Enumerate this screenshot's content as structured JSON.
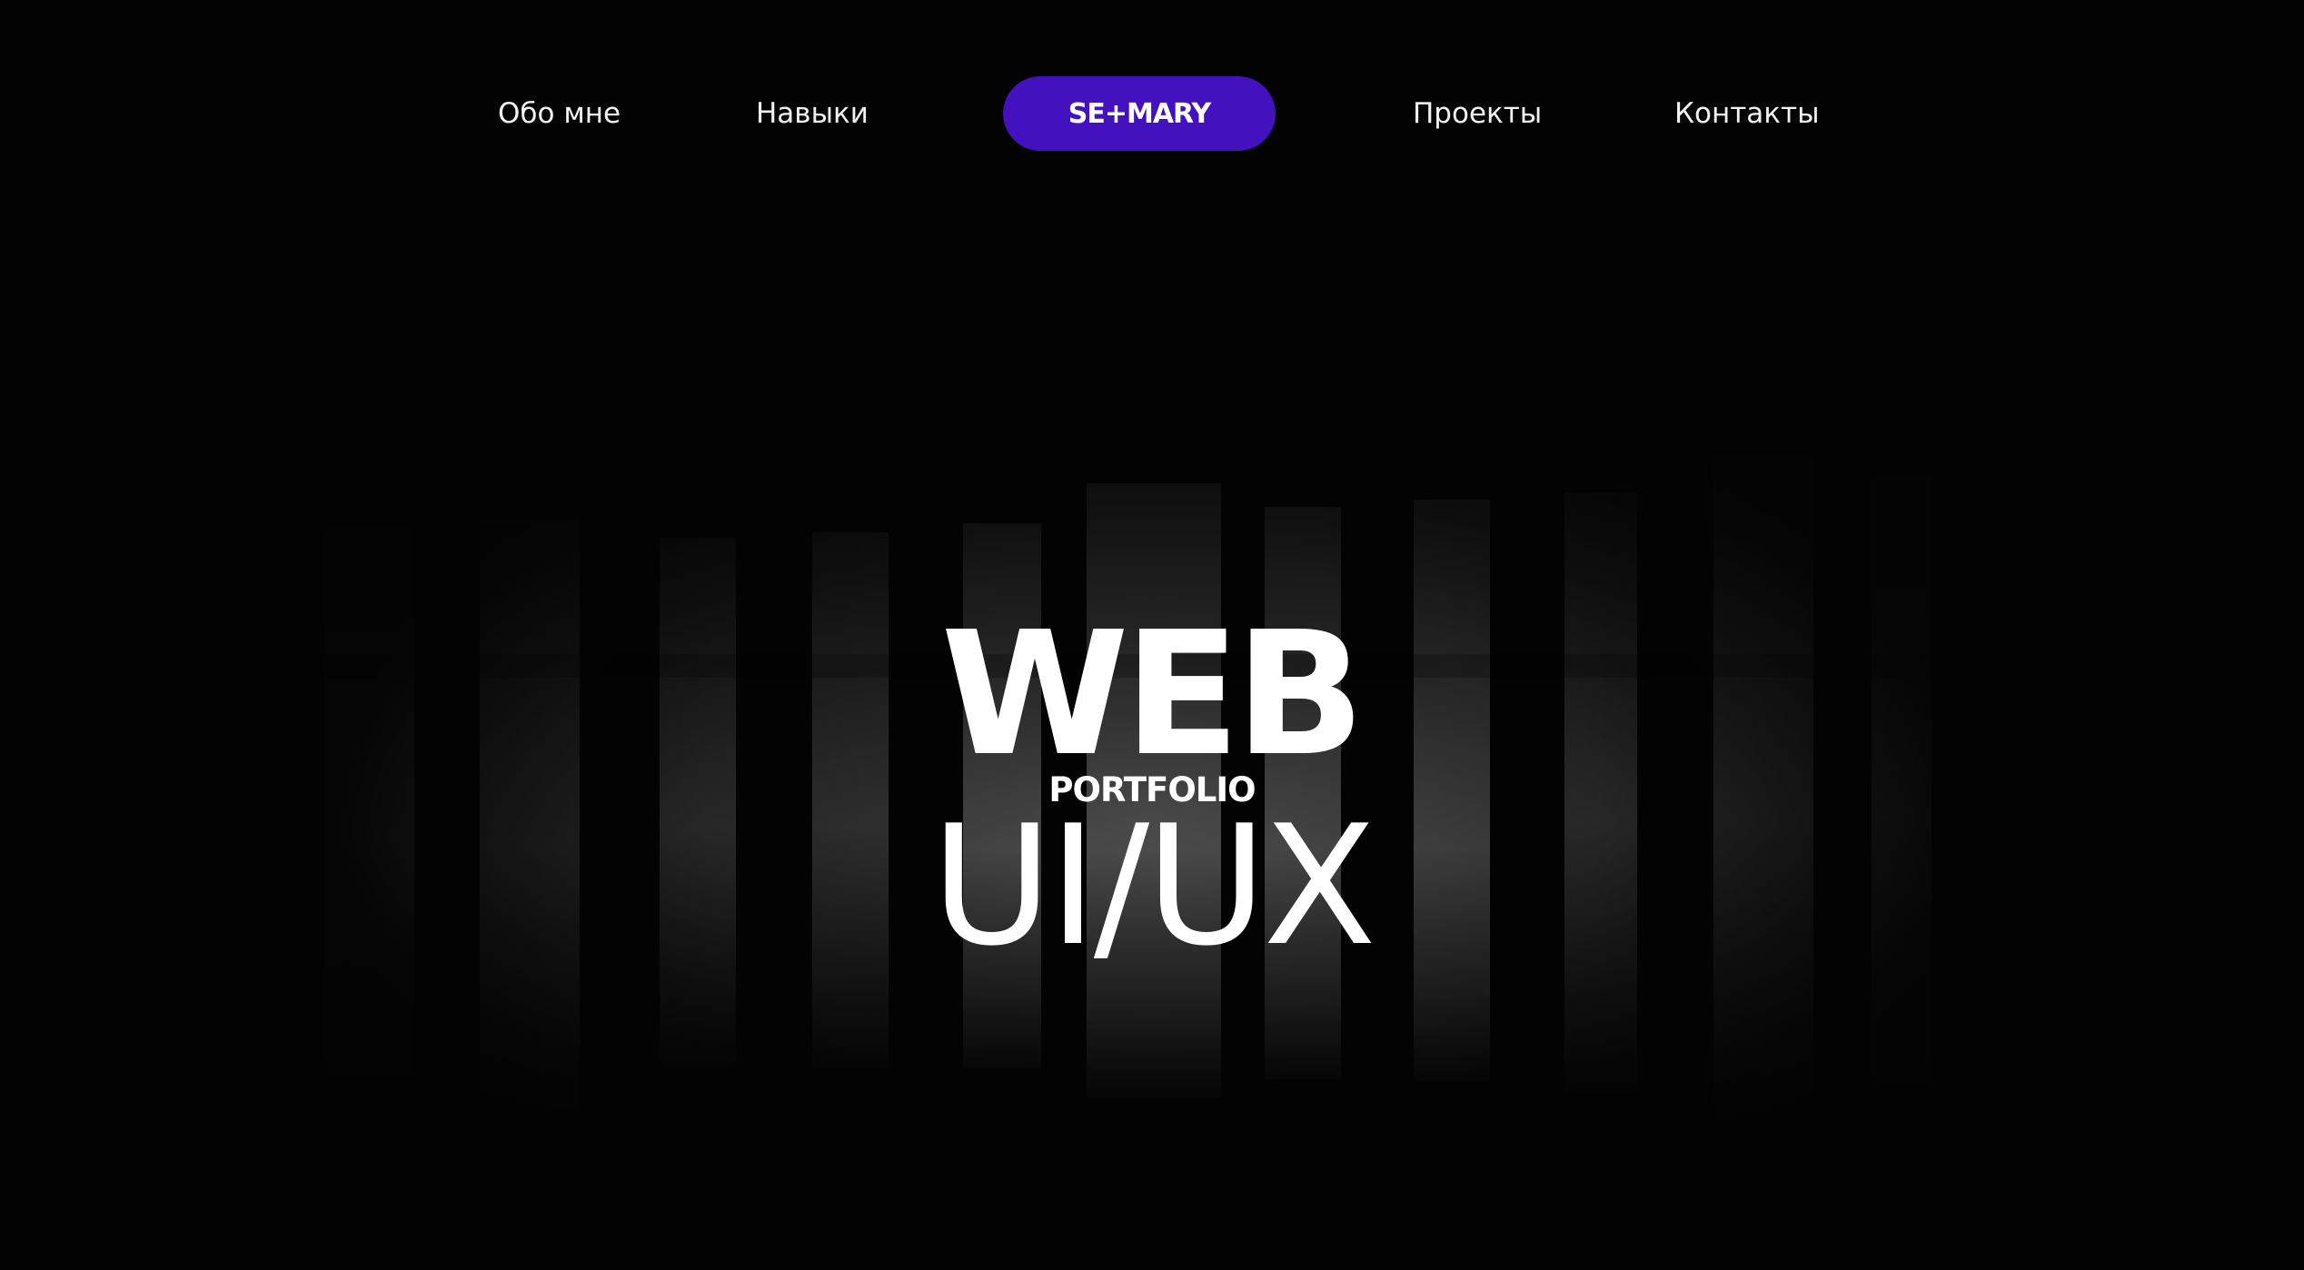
{
  "nav": {
    "items": [
      {
        "label": "Обо мне"
      },
      {
        "label": "Навыки"
      },
      {
        "label": "Проекты"
      },
      {
        "label": "Контакты"
      }
    ],
    "logo": "SE+MARY",
    "logo_color": "#4311BD"
  },
  "hero": {
    "title_top": "WEB",
    "subtitle": "PORTFOLIO",
    "title_bottom": "UI/UX",
    "background": "dark photo of tall backlit window columns"
  },
  "colors": {
    "background": "#030303",
    "accent": "#4311BD",
    "text": "#FFFFFF"
  }
}
